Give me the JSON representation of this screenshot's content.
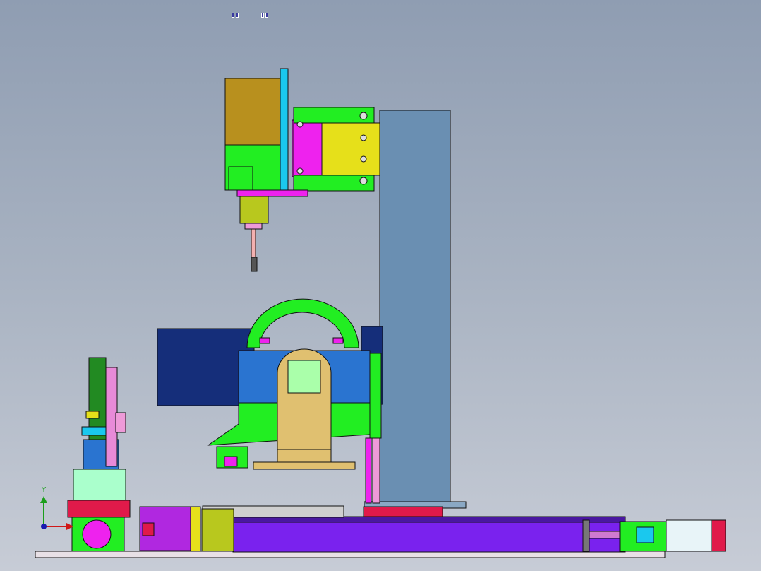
{
  "viewport": {
    "background_top": "#8f9db2",
    "background_bottom": "#c7ccd6"
  },
  "triad": {
    "y_label": "Y",
    "y_color": "#1a9e1a",
    "x_color": "#d01818",
    "origin_color": "#1a1ab0"
  },
  "top_toolbar": {
    "icons": [
      "view-orientation-icon",
      "display-style-icon"
    ]
  },
  "colors": {
    "column": "#6a8fb2",
    "spindle_motor": "#b8901e",
    "green": "#22ee22",
    "magenta": "#ee22ee",
    "yellow": "#e6e01a",
    "cyan": "#1ac8ee",
    "tan": "#e0c070",
    "navy": "#152e7a",
    "blue": "#2a74d0",
    "purple": "#7a22ee",
    "pink": "#ee9ad8",
    "red": "#e01a4a"
  }
}
